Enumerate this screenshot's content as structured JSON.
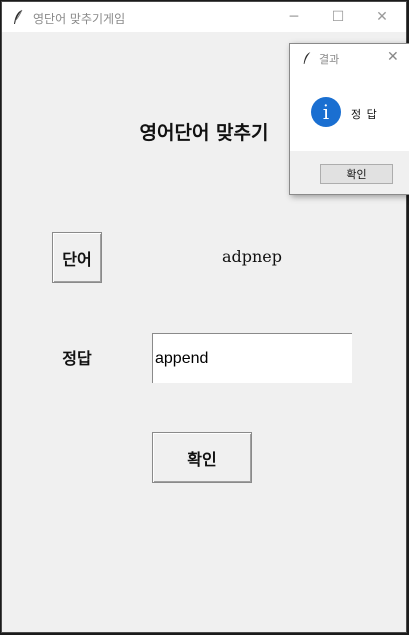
{
  "window": {
    "title": "영단어 맞추기게임",
    "minimize_glyph": "─",
    "maximize_glyph": "☐",
    "close_glyph": "✕"
  },
  "main": {
    "heading": "영어단어 맞추기",
    "word_button_label": "단어",
    "scrambled_word": "adpnep",
    "answer_label": "정답",
    "answer_value": "append",
    "confirm_button_label": "확인"
  },
  "dialog": {
    "title": "결과",
    "message": "정 답",
    "ok_label": "확인",
    "icon": "info-icon",
    "close_glyph": "✕"
  },
  "colors": {
    "info_icon": "#1a6fd1",
    "background": "#f0f0f0"
  }
}
